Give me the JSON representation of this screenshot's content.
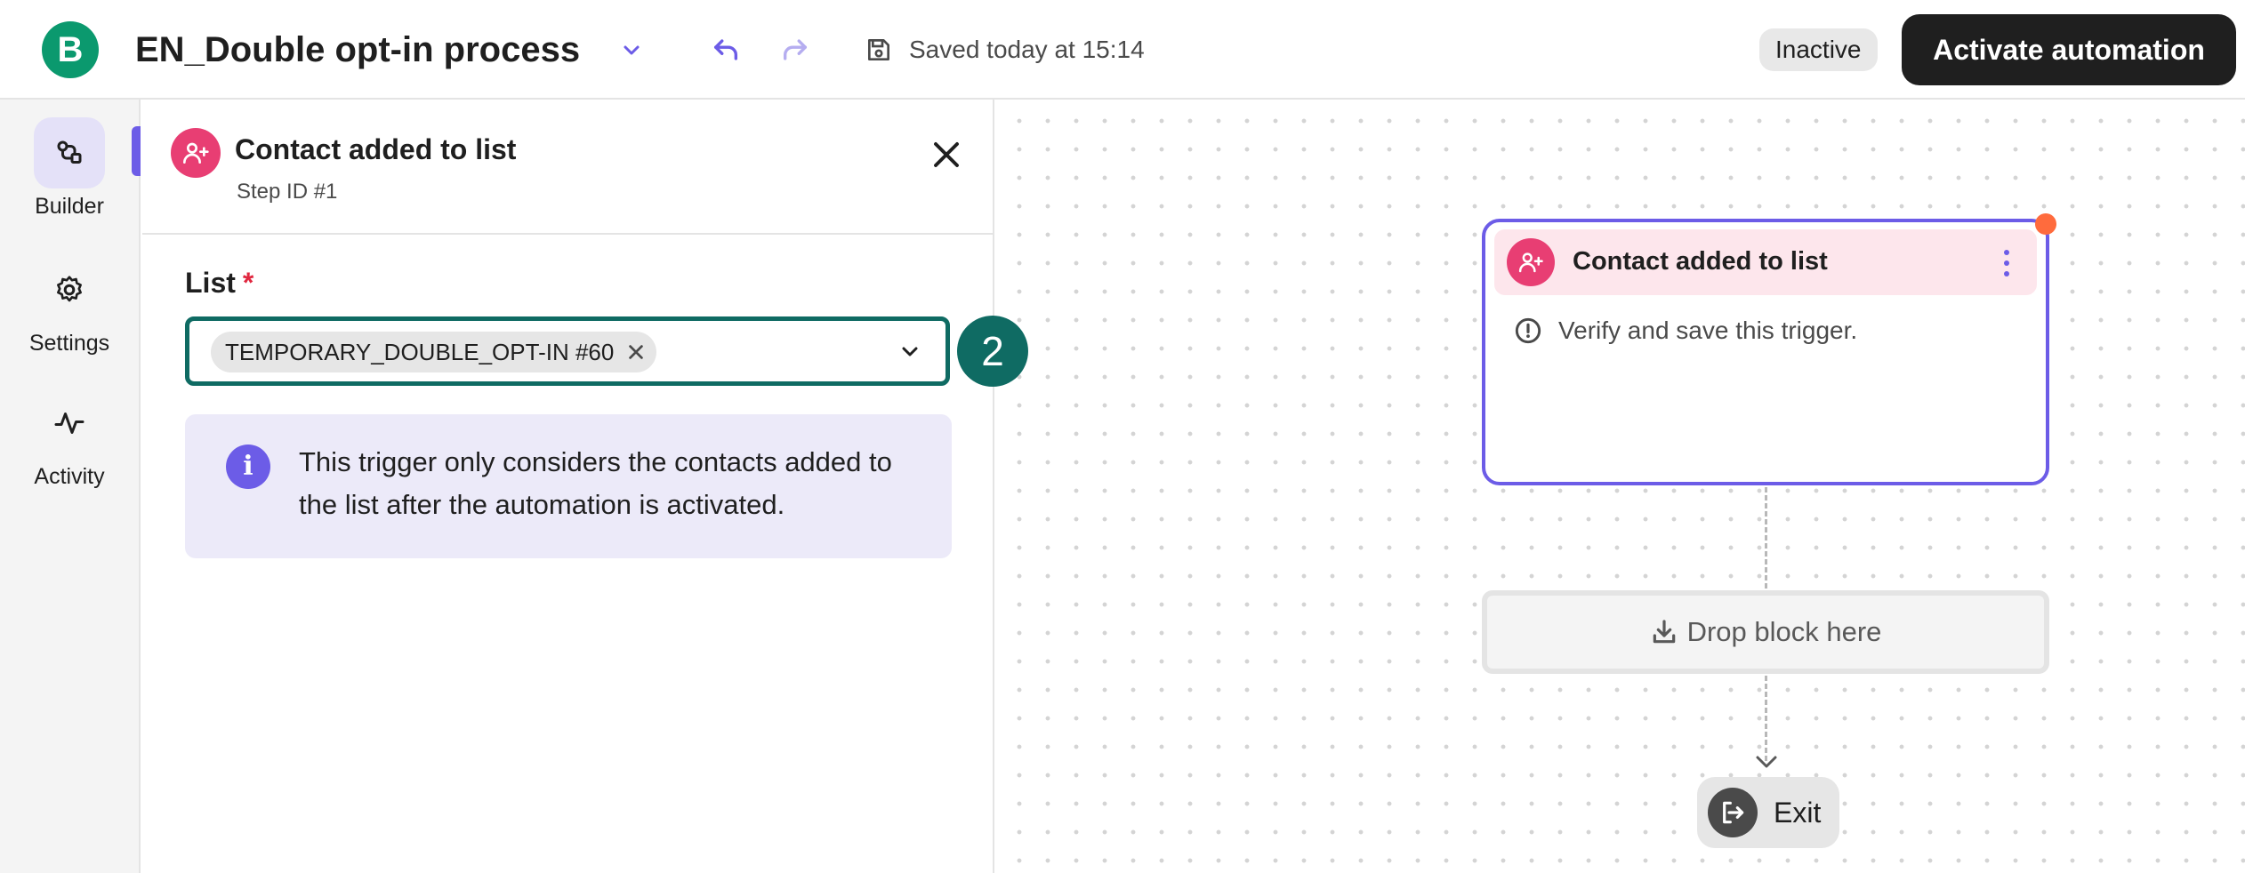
{
  "header": {
    "logo_letter": "B",
    "title": "EN_Double opt-in process",
    "save_status": "Saved today at 15:14",
    "status_badge": "Inactive",
    "activate_button": "Activate automation"
  },
  "sidebar": {
    "items": [
      {
        "label": "Builder",
        "icon": "builder-icon",
        "active": true
      },
      {
        "label": "Settings",
        "icon": "gear-icon",
        "active": false
      },
      {
        "label": "Activity",
        "icon": "activity-icon",
        "active": false
      }
    ]
  },
  "panel": {
    "title": "Contact added to list",
    "subtitle": "Step ID #1",
    "field_label": "List",
    "required_mark": "*",
    "selected_list": "TEMPORARY_DOUBLE_OPT-IN #60",
    "step_badge": "2",
    "info_icon_glyph": "i",
    "info_text": "This trigger only considers the contacts added to the list after the automation is activated."
  },
  "canvas": {
    "trigger_node": {
      "title": "Contact added to list",
      "warning": "Verify and save this trigger."
    },
    "drop_block": "Drop block here",
    "exit": "Exit"
  },
  "colors": {
    "brand_green": "#0b996e",
    "accent_purple": "#6c5ce7",
    "trigger_pink": "#e83e73",
    "focus_teal": "#0f6b63",
    "required_red": "#e0273f",
    "alert_orange": "#ff6b3d"
  }
}
